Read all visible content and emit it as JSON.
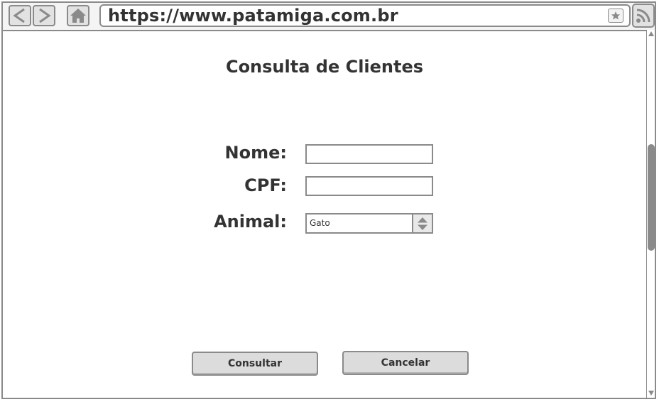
{
  "browser": {
    "url": "https://www.patamiga.com.br",
    "icons": {
      "back": "chevron-left-icon",
      "forward": "chevron-right-icon",
      "home": "home-icon",
      "bookmark": "star-icon",
      "feed": "rss-icon"
    }
  },
  "page": {
    "title": "Consulta de Clientes"
  },
  "form": {
    "nome": {
      "label": "Nome:",
      "value": ""
    },
    "cpf": {
      "label": "CPF:",
      "value": ""
    },
    "animal": {
      "label": "Animal:",
      "selected": "Gato"
    }
  },
  "actions": {
    "consultar_label": "Consultar",
    "cancelar_label": "Cancelar"
  },
  "colors": {
    "chrome_border": "#8a8a8a",
    "text": "#333333",
    "button_fill": "#dcdcdc"
  }
}
